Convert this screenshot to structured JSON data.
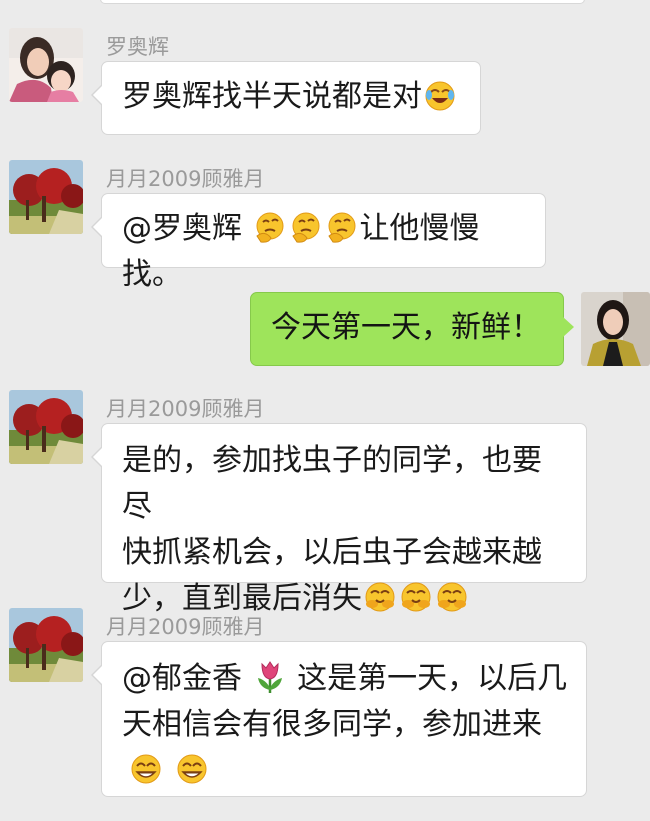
{
  "messages": [
    {
      "sender": "罗奥辉",
      "text": "罗奥辉找半天说都是对",
      "emoji": "laughing-crying-emoji"
    },
    {
      "sender": "月月2009顾雅月",
      "mention": "@罗奥辉",
      "emoji": "thinking-emoji",
      "text": "让他慢慢找。"
    },
    {
      "sender": "",
      "text": "今天第一天，新鲜！"
    },
    {
      "sender": "月月2009顾雅月",
      "lines": [
        "是的，参加找虫子的同学，也要尽",
        "快抓紧机会，以后虫子会越来越",
        "少，直到最后消失"
      ],
      "emoji": "giggle-emoji"
    },
    {
      "sender": "月月2009顾雅月",
      "mention": "@郁金香",
      "emoji_after_mention": "tulip-icon",
      "lines": [
        "这是第一天，以后几",
        "天相信会有很多同学，参加进来"
      ],
      "emoji": "grin-emoji"
    }
  ],
  "colors": {
    "background": "#ebebeb",
    "incoming_bubble": "#ffffff",
    "outgoing_bubble": "#9ee45b",
    "sender_name": "#9a9a9a"
  }
}
